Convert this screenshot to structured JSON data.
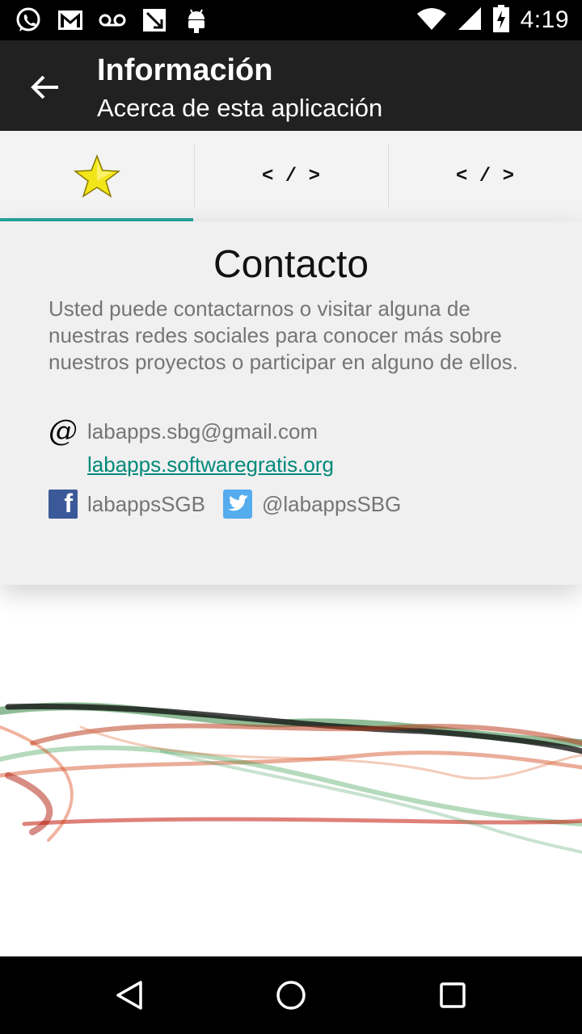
{
  "status_bar": {
    "time": "4:19",
    "left_icons": [
      "whatsapp-icon",
      "gmail-icon",
      "voicemail-icon",
      "missed-call-icon",
      "android-icon"
    ],
    "right_icons": [
      "wifi-icon",
      "signal-icon",
      "battery-charging-icon"
    ]
  },
  "app_bar": {
    "title": "Información",
    "subtitle": "Acerca de esta aplicación",
    "back_icon": "arrow-back-icon"
  },
  "tabs": [
    {
      "icon": "star-icon",
      "label": "",
      "selected": true
    },
    {
      "label": "< / >",
      "selected": false
    },
    {
      "label": "< / >",
      "selected": false
    }
  ],
  "contact": {
    "heading": "Contacto",
    "description": "Usted puede contactarnos o visitar alguna de nuestras redes sociales para conocer más sobre nuestros proyectos o participar en alguno de ellos.",
    "email_symbol": "@",
    "email": "labapps.sbg@gmail.com",
    "website": "labapps.softwaregratis.org",
    "facebook_letter": "f",
    "facebook": "labappsSGB",
    "twitter": "@labappsSBG"
  },
  "colors": {
    "accent": "#26a69a",
    "link": "#00897b",
    "app_bar": "#212121",
    "facebook": "#3b5998",
    "twitter": "#55acee",
    "star": "#f2e61a"
  },
  "nav_bar": [
    "back-triangle-icon",
    "home-circle-icon",
    "recents-square-icon"
  ]
}
